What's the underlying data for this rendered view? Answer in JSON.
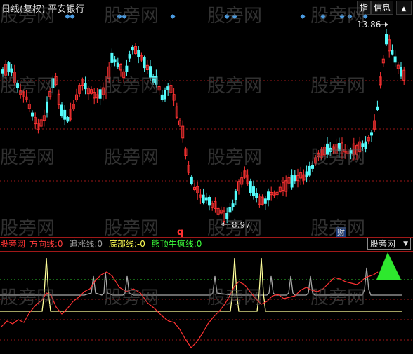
{
  "title": "日线(复权) 平安银行",
  "buttons": {
    "index": "指",
    "info": "信息"
  },
  "price_chart": {
    "high_label": "13.86",
    "low_label": "8.97",
    "marker_q": "q",
    "marker_cai": "财",
    "colors": {
      "up": "#ff3232",
      "down": "#54fcfc",
      "grid": "#a01818",
      "marker": "#4a9adf",
      "label": "#e6e6e6"
    }
  },
  "indicator": {
    "name": "股旁网",
    "lines": [
      {
        "label": "方向线:",
        "value": "0",
        "color": "#ff3c3c"
      },
      {
        "label": "追涨线:",
        "value": "0",
        "color": "#a0a0a0"
      },
      {
        "label": "底部线:",
        "value": "-0",
        "color": "#ffff54"
      },
      {
        "label": "熊顶牛疯线:",
        "value": "0",
        "color": "#3cff3c"
      }
    ],
    "selector": "股旁网"
  },
  "watermark": "股旁网",
  "icons": {
    "dropdown": "triangle-down-icon",
    "event": "diamond-icon",
    "arrow": "arrow-right-icon"
  }
}
